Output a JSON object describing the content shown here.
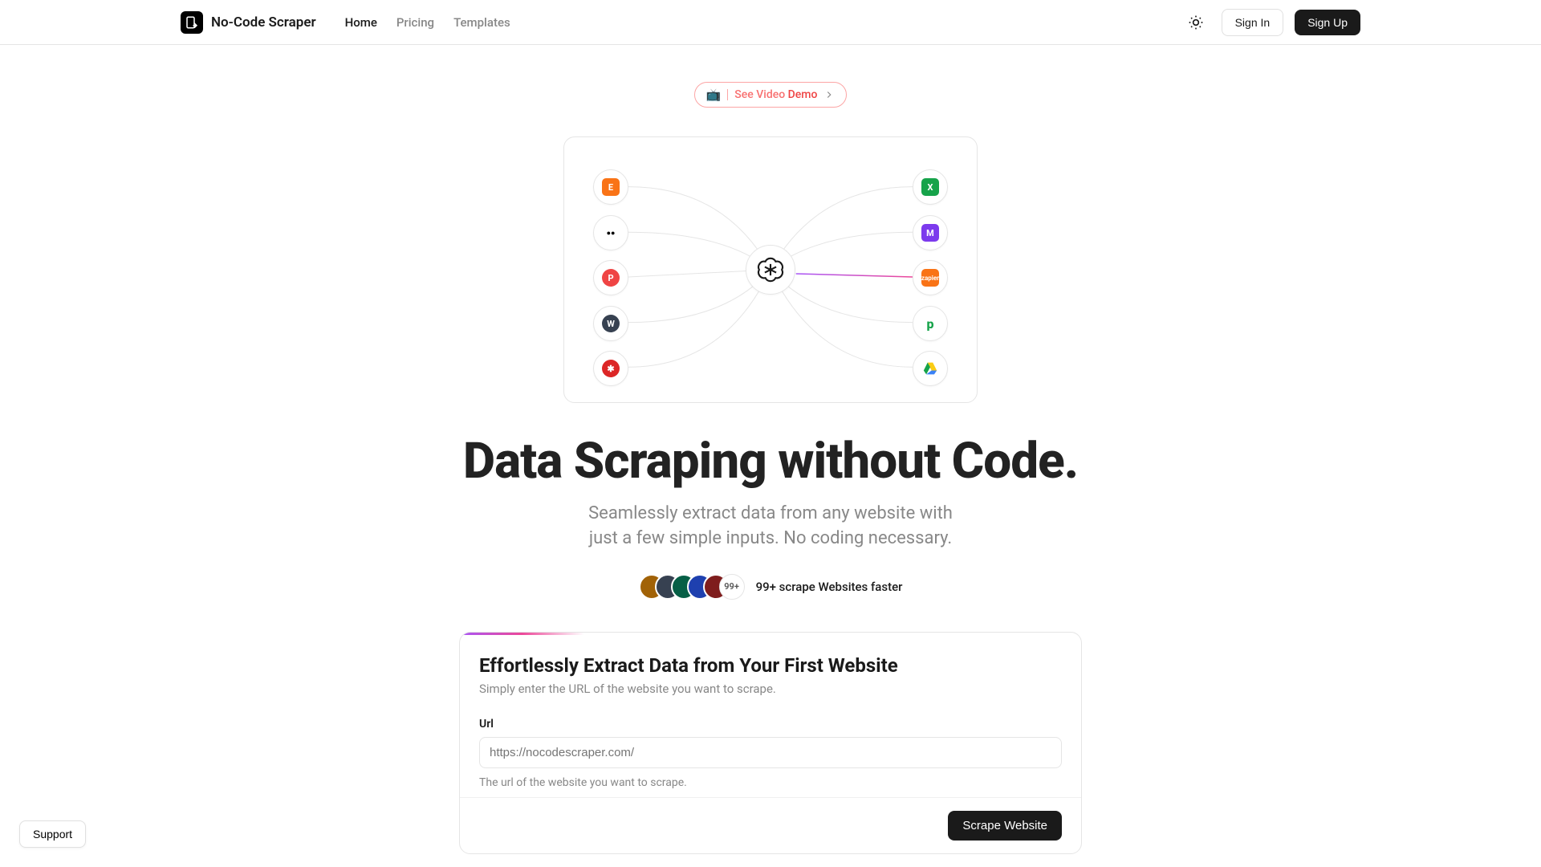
{
  "header": {
    "brand_name": "No-Code Scraper",
    "nav": {
      "home": "Home",
      "pricing": "Pricing",
      "templates": "Templates"
    },
    "sign_in_label": "Sign In",
    "sign_up_label": "Sign Up"
  },
  "video_demo": {
    "emoji": "📺",
    "text_see_video": "See Video ",
    "text_demo": "Demo"
  },
  "diagram": {
    "left_nodes": [
      {
        "name": "etsy-icon",
        "bg": "#f97316",
        "glyph": "E"
      },
      {
        "name": "medium-icon",
        "bg": "#000000",
        "glyph": "●●"
      },
      {
        "name": "producthunt-icon",
        "bg": "#ef4444",
        "glyph": "P",
        "round": true
      },
      {
        "name": "wordpress-icon",
        "bg": "#374151",
        "glyph": "W",
        "round": true
      },
      {
        "name": "yelp-icon",
        "bg": "#dc2626",
        "glyph": "✱",
        "round": true
      }
    ],
    "right_nodes": [
      {
        "name": "excel-icon",
        "bg": "#16a34a",
        "glyph": "X"
      },
      {
        "name": "make-icon",
        "bg": "#7c3aed",
        "glyph": "M"
      },
      {
        "name": "zapier-icon",
        "bg": "#f97316",
        "glyph": "—"
      },
      {
        "name": "pipedrive-icon",
        "bg": "#ffffff",
        "glyph": "p",
        "fg": "#16a34a"
      },
      {
        "name": "gdrive-icon",
        "bg": "#ffffff",
        "glyph": "▲",
        "fg": "#facc15"
      }
    ],
    "center_name": "openai-icon"
  },
  "hero": {
    "title": "Data Scraping without Code.",
    "sub_line1": "Seamlessly extract data from any website with",
    "sub_line2": "just a few simple inputs. No coding necessary."
  },
  "social_proof": {
    "avatar_count": "99+",
    "text": "99+ scrape Websites faster",
    "avatar_colors": [
      "#a16207",
      "#374151",
      "#065f46",
      "#1e40af",
      "#7f1d1d"
    ]
  },
  "card": {
    "title": "Effortlessly Extract Data from Your First Website",
    "subtitle": "Simply enter the URL of the website you want to scrape.",
    "url_label": "Url",
    "url_placeholder": "https://nocodescraper.com/",
    "url_hint": "The url of the website you want to scrape.",
    "scrape_button": "Scrape Website"
  },
  "support_label": "Support"
}
